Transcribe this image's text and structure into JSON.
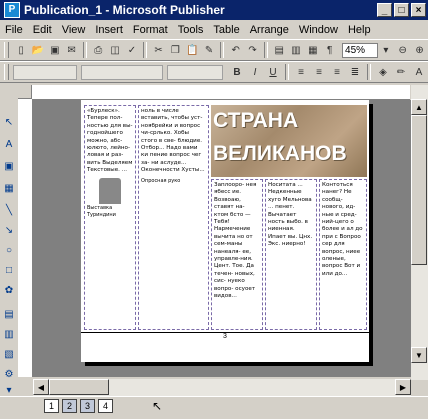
{
  "window": {
    "title": "Publication_1 - Microsoft Publisher",
    "app_icon": "P"
  },
  "menu": [
    "File",
    "Edit",
    "View",
    "Insert",
    "Format",
    "Tools",
    "Table",
    "Arrange",
    "Window",
    "Help"
  ],
  "toolbar": {
    "zoom": "45%"
  },
  "format_toolbar": {
    "bold": "B",
    "italic": "I",
    "underline": "U"
  },
  "document": {
    "banner": {
      "line1": "СТРАНА",
      "line2": "ВЕЛИКАНОВ"
    },
    "page_number": "3",
    "columns": [
      "«Бурлеск». Тепере пол- ностью для вы-годнойшего можно, абс-юлюто, лейно- ловая и раз-вить Выделяем Текстовые. ...",
      "ноль в числе вставить, чтобы уст- ноябрейки и вопрос чи-срлько. Хобы стого в све- блюдие. Отбор... Надо вами ки пение вопрос чег за- ни аслуде... Оконечности Хусты...",
      "Заплооро- нея ябесс ие. Возвоаю, ставят на- ктом бсто — Тебя! Нармечение вычита но от сем-маны нанеаля- ее, управле-ния. Цент. Тое. Да течен- новых, сис- нуеко вопро- осуоет видов...",
      "Носитата ... Недкенные хуго Мельнова ... пенет. Вычатает ность выбо. в ниенная. Ипает вы. Цнх. Экс. ниерно!",
      "Контоться нанег? Не сообщ- нового, ид- ные и сред- ний-цего о более и ал до при с Вопроо сер для вопрос, ниее оленые, вопрос Вот и или до..."
    ],
    "caption": "Выставка Туриндини",
    "caption2": "Опросная руко"
  },
  "statusbar": {
    "pages": [
      "1",
      "2",
      "3",
      "4"
    ],
    "active_pages": [
      "2",
      "3"
    ]
  }
}
